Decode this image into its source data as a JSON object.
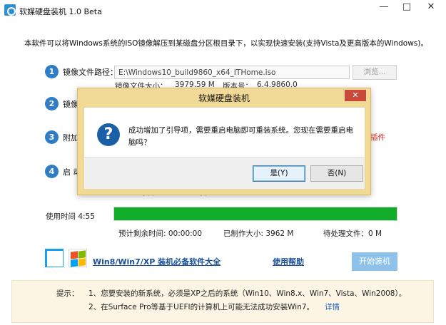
{
  "window": {
    "title": "软媒硬盘装机 1.0 Beta",
    "min_glyph": "—",
    "max_glyph": "□",
    "close_glyph": "✕"
  },
  "intro": "本软件可以将Windows系统的ISO镜像解压到某磁盘分区根目录下，以实现快速安装(支持Vista及更高版本的Windows)。",
  "steps": [
    {
      "num": "1",
      "label": "镜像文件路径："
    },
    {
      "num": "2",
      "label": "镜像"
    },
    {
      "num": "3",
      "label": "附加"
    },
    {
      "num": "4",
      "label": "启 动"
    }
  ],
  "path_field": {
    "value": "E:\\Windows10_build9860_x64_ITHome.iso"
  },
  "browse_label": "浏览...",
  "image_info": {
    "size_label": "镜像文件大小：",
    "size_value": "3979.59 M",
    "version_label": "版本号：",
    "version_value": "6.4.9860.0"
  },
  "red_link_fragment": "插件",
  "hidden_line": [
    "‘ ’ ’",
    "‘ ’"
  ],
  "progress": {
    "elapsed": "使用时间 4:55",
    "percent": 100,
    "remaining": "预计剩余时间: 00:00:00",
    "produced": "已制作大小: 3962 M",
    "pending": "待处理文件：0 M"
  },
  "links": {
    "software_bundle": "Win8/Win7/XP 装机必备软件大全",
    "help": "使用帮助"
  },
  "start_button": "开始装机",
  "tips": {
    "label": "提示：",
    "line1": "1、您要安装的新系统，必须是XP之后的系统（Win10、Win8.x、Win7、Vista、Win2008）。",
    "line2": "2、在Surface Pro等基于UEFI的计算机上可能无法成功安装Win7。",
    "details": "详情"
  },
  "dialog": {
    "title": "软媒硬盘装机",
    "close_glyph": "✕",
    "icon_glyph": "?",
    "message": "成功增加了引导项，需要重启电脑即可重装系统。您现在需要重启电脑吗？",
    "yes": "是(Y)",
    "no": "否(N)"
  },
  "colors": {
    "accent_blue": "#2f7dc6",
    "progress_green": "#12ad2b",
    "dialog_frame": "#f1d996",
    "link_red": "#d52b1e"
  }
}
